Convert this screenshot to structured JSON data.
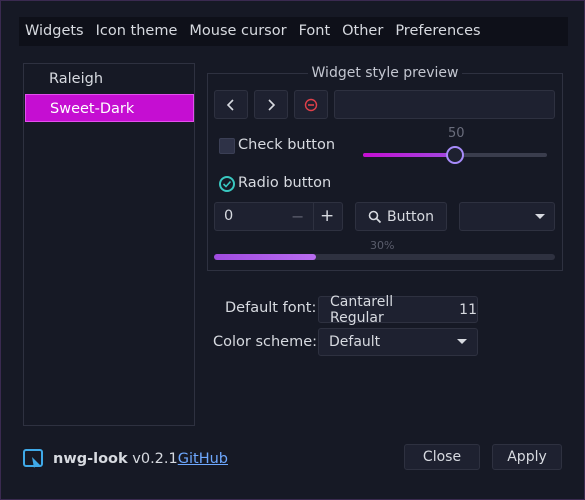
{
  "menubar": {
    "items": [
      "Widgets",
      "Icon theme",
      "Mouse cursor",
      "Font",
      "Other",
      "Preferences"
    ]
  },
  "theme_list": {
    "items": [
      "Raleigh",
      "Sweet-Dark"
    ],
    "selected": "Sweet-Dark"
  },
  "preview": {
    "title": "Widget style preview",
    "check_label": "Check button",
    "radio_label": "Radio button",
    "slider_value": "50",
    "slider_fraction": 0.5,
    "spin_value": "0",
    "spin_minus": "−",
    "spin_plus": "+",
    "button_label": "Button",
    "progress_text": "30%",
    "progress_fraction": 0.3
  },
  "settings": {
    "font_label": "Default font:",
    "font_name": "Cantarell Regular",
    "font_size": "11",
    "color_scheme_label": "Color scheme:",
    "color_scheme_value": "Default"
  },
  "footer": {
    "app_name": "nwg-look",
    "version": "v0.2.1",
    "github_label": "GitHub",
    "close_label": "Close",
    "apply_label": "Apply"
  },
  "colors": {
    "accent": "#c50ed2",
    "slider_knob": "#a78bfa",
    "radio": "#39c7c0",
    "link": "#6ea8ff"
  }
}
